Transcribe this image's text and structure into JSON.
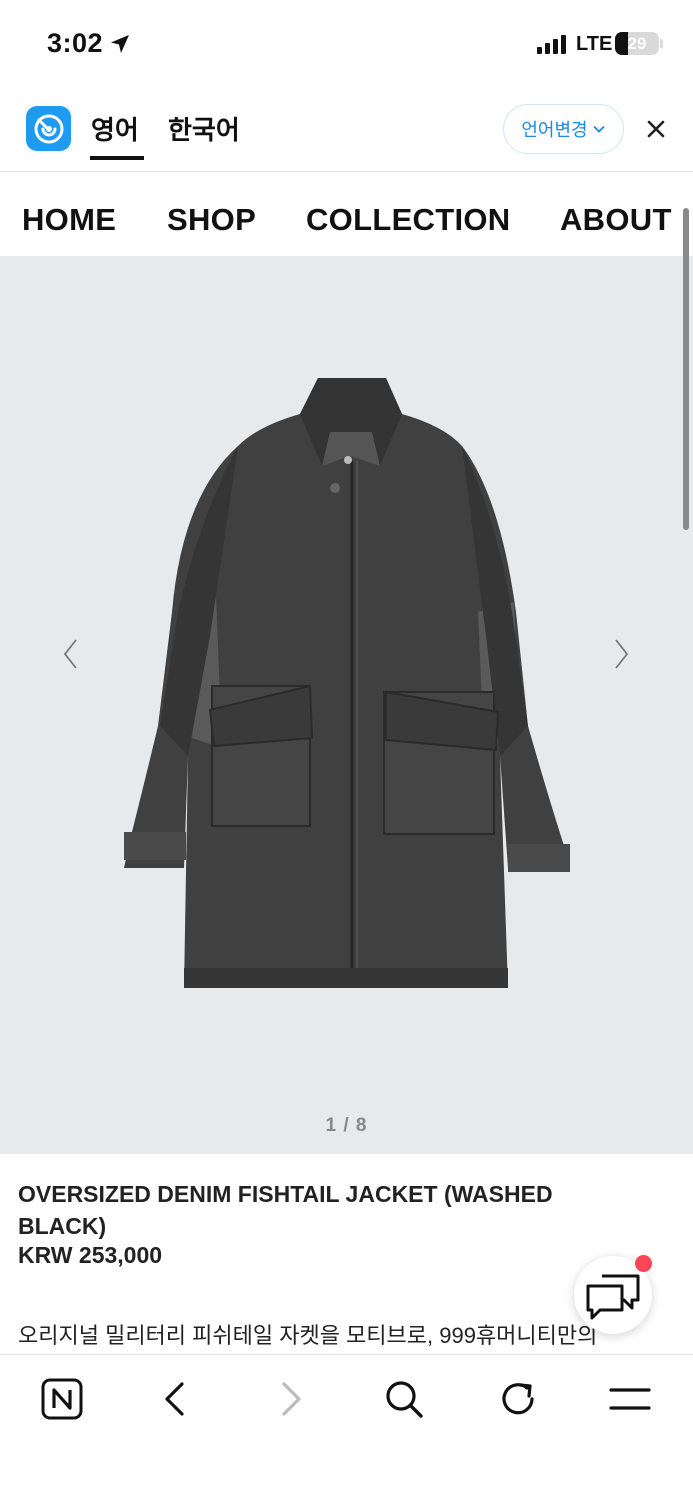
{
  "status_bar": {
    "time": "3:02",
    "network": "LTE",
    "battery": "29",
    "battery_level": 0.29
  },
  "translate_bar": {
    "tabs": [
      {
        "label": "영어",
        "active": true
      },
      {
        "label": "한국어",
        "active": false
      }
    ],
    "change_language_label": "언어변경",
    "accent_color": "#1e9bf0"
  },
  "site_nav": {
    "items": [
      {
        "label": "HOME"
      },
      {
        "label": "SHOP"
      },
      {
        "label": "COLLECTION"
      },
      {
        "label": "ABOUT"
      }
    ]
  },
  "gallery": {
    "pager": "1 / 8"
  },
  "product": {
    "title": "OVERSIZED DENIM FISHTAIL JACKET (WASHED BLACK)",
    "price": "KRW 253,000",
    "description": "오리지널 밀리터리 피쉬테일 자켓을 모티브로, 999휴머니티만의"
  },
  "icons": {
    "chat": "chat-bubbles-icon",
    "home": "naver-n-icon",
    "back": "chevron-left-icon",
    "forward": "chevron-right-icon",
    "search": "search-icon",
    "reload": "reload-icon",
    "menu": "menu-icon"
  },
  "colors": {
    "notification_dot": "#ff4557",
    "image_background": "#e8e9ea"
  }
}
